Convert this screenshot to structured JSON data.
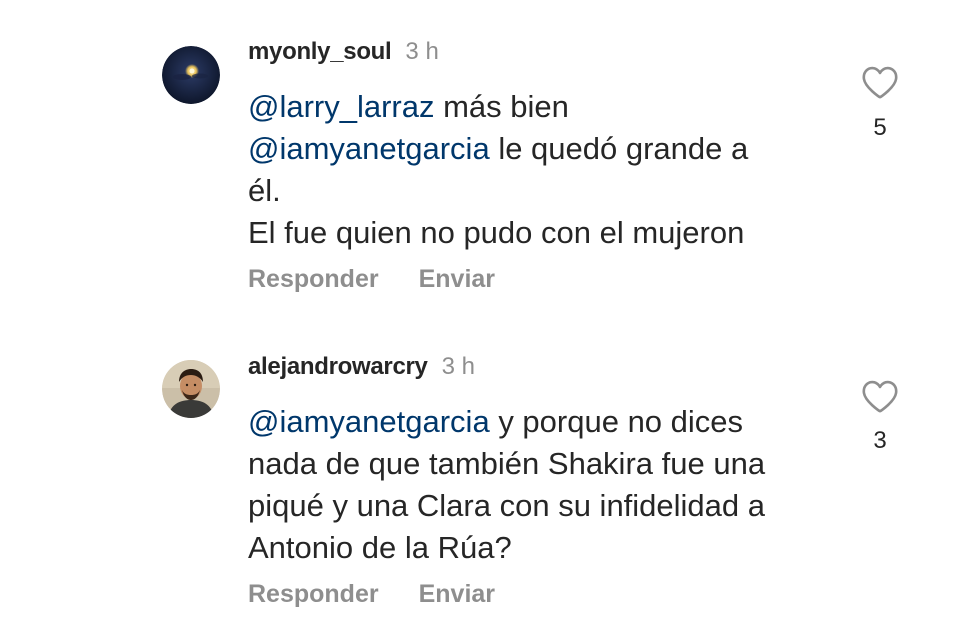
{
  "comments": [
    {
      "username": "myonly_soul",
      "time": "3 h",
      "avatar": "moon-night-photo",
      "lines": [
        [
          {
            "text": "@larry_larraz",
            "mention": true
          },
          {
            "text": " más bien",
            "mention": false
          }
        ],
        [
          {
            "text": "@iamyanetgarcia",
            "mention": true
          },
          {
            "text": " le quedó grande a",
            "mention": false
          }
        ],
        [
          {
            "text": "él.",
            "mention": false
          }
        ],
        [
          {
            "text": "El fue quien no pudo con el mujeron",
            "mention": false
          }
        ]
      ],
      "reply_label": "Responder",
      "send_label": "Enviar",
      "likes": "5"
    },
    {
      "username": "alejandrowarcry",
      "time": "3 h",
      "avatar": "man-portrait-photo",
      "lines": [
        [
          {
            "text": "@iamyanetgarcia",
            "mention": true
          },
          {
            "text": " y porque no dices",
            "mention": false
          }
        ],
        [
          {
            "text": "nada de que también Shakira fue una",
            "mention": false
          }
        ],
        [
          {
            "text": "piqué y una Clara con su infidelidad a",
            "mention": false
          }
        ],
        [
          {
            "text": "Antonio de la Rúa?",
            "mention": false
          }
        ]
      ],
      "reply_label": "Responder",
      "send_label": "Enviar",
      "likes": "3"
    }
  ],
  "colors": {
    "text": "#262626",
    "mention": "#00376b",
    "muted": "#8e8e8e"
  }
}
